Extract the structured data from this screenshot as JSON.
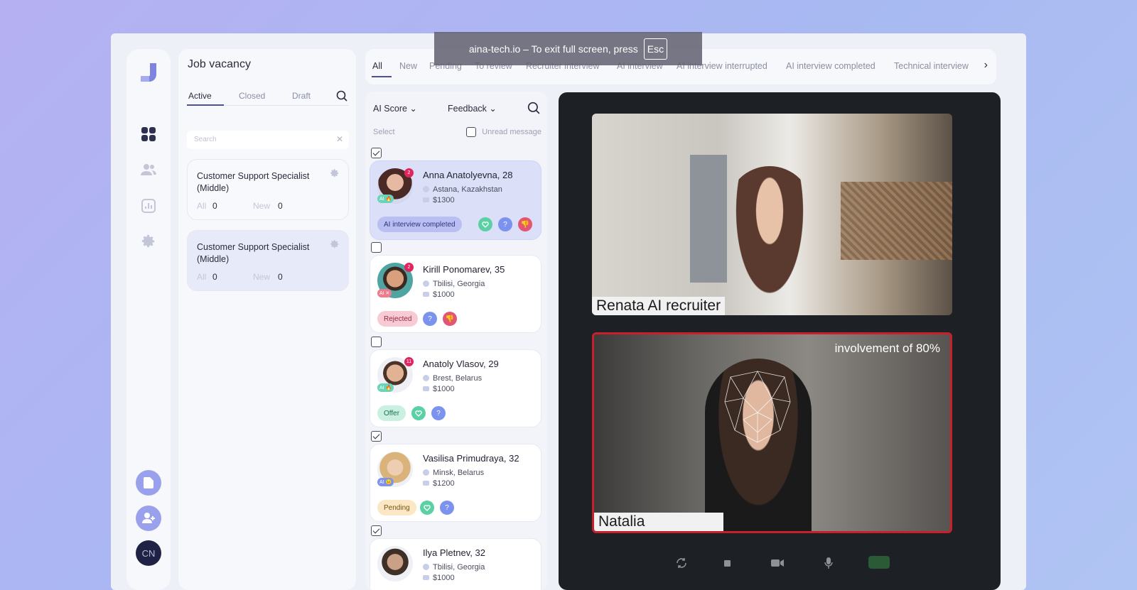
{
  "toast": {
    "text": "aina-tech.io – To exit full screen, press",
    "key": "Esc"
  },
  "sidebar": {
    "avatar_initials": "CN"
  },
  "vacancy_panel": {
    "title": "Job vacancy",
    "tabs": [
      "Active",
      "Closed",
      "Draft"
    ],
    "search_placeholder": "Search",
    "cards": [
      {
        "title": "Customer Support Specialist (Middle)",
        "all_label": "All",
        "all_count": "0",
        "new_label": "New",
        "new_count": "0"
      },
      {
        "title": "Customer Support Specialist (Middle)",
        "all_label": "All",
        "all_count": "0",
        "new_label": "New",
        "new_count": "0"
      }
    ]
  },
  "stage_tabs": [
    "All",
    "New",
    "Pending",
    "To review",
    "Recruiter interview",
    "AI interview",
    "AI interview interrupted",
    "AI interview completed",
    "Technical interview"
  ],
  "candidates_panel": {
    "filter_score": "AI Score",
    "filter_feedback": "Feedback",
    "select_label": "Select",
    "unread_label": "Unread message",
    "items": [
      {
        "name": "Anna Anatolyevna, 28",
        "location": "Astana, Kazakhstan",
        "salary": "$1300",
        "status": "AI interview completed",
        "badge": "2",
        "checked": true
      },
      {
        "name": "Kirill Ponomarev, 35",
        "location": "Tbilisi, Georgia",
        "salary": "$1000",
        "status": "Rejected",
        "badge": "2",
        "checked": false
      },
      {
        "name": "Anatoly Vlasov, 29",
        "location": "Brest, Belarus",
        "salary": "$1000",
        "status": "Offer",
        "badge": "11",
        "checked": false
      },
      {
        "name": "Vasilisa Primudraya, 32",
        "location": "Minsk, Belarus",
        "salary": "$1200",
        "status": "Pending",
        "badge": "",
        "checked": true
      },
      {
        "name": "Ilya Pletnev, 32",
        "location": "Tbilisi, Georgia",
        "salary": "$1000",
        "status": "",
        "badge": "",
        "checked": true
      }
    ]
  },
  "video": {
    "top_name": "Renata AI recruiter",
    "bottom_name": "Natalia",
    "involvement": "involvement of 80%"
  },
  "colors": {
    "accent": "#4a4f9a",
    "badge": "#e0245e",
    "highlight_card": "#dcdff8",
    "video_bg": "#1d2024",
    "active_border": "#c8202a"
  }
}
